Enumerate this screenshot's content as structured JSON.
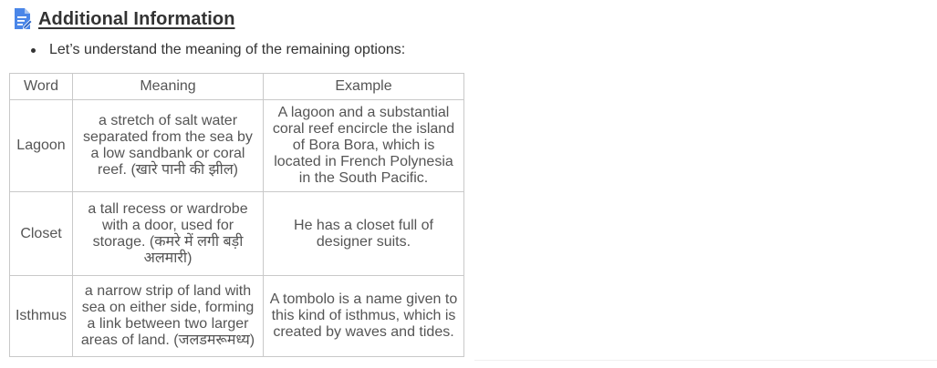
{
  "heading": {
    "icon": "document-edit-icon",
    "title": "Additional Information",
    "icon_color": "#4a86e8"
  },
  "intro": {
    "bullet": "Let’s understand the meaning of the remaining options:"
  },
  "table": {
    "headers": [
      "Word",
      "Meaning",
      "Example"
    ],
    "rows": [
      {
        "word": "Lagoon",
        "meaning": "a stretch of salt water separated from the sea by a low sandbank or coral reef. (खारे पानी की झील)",
        "example": "A lagoon and a substantial coral reef encircle the island of Bora Bora, which is located in French Polynesia in the South Pacific."
      },
      {
        "word": "Closet",
        "meaning": "a tall recess or wardrobe with a door, used for storage. (कमरे में लगी बड़ी अलमारी)",
        "example": "He has a closet full of designer suits."
      },
      {
        "word": "Isthmus",
        "meaning": "a narrow strip of land with sea on either side, forming a link between two larger areas of land. (जलडमरूमध्य)",
        "example": "A tombolo is a name given to this kind of isthmus, which is created by waves and tides."
      }
    ]
  }
}
